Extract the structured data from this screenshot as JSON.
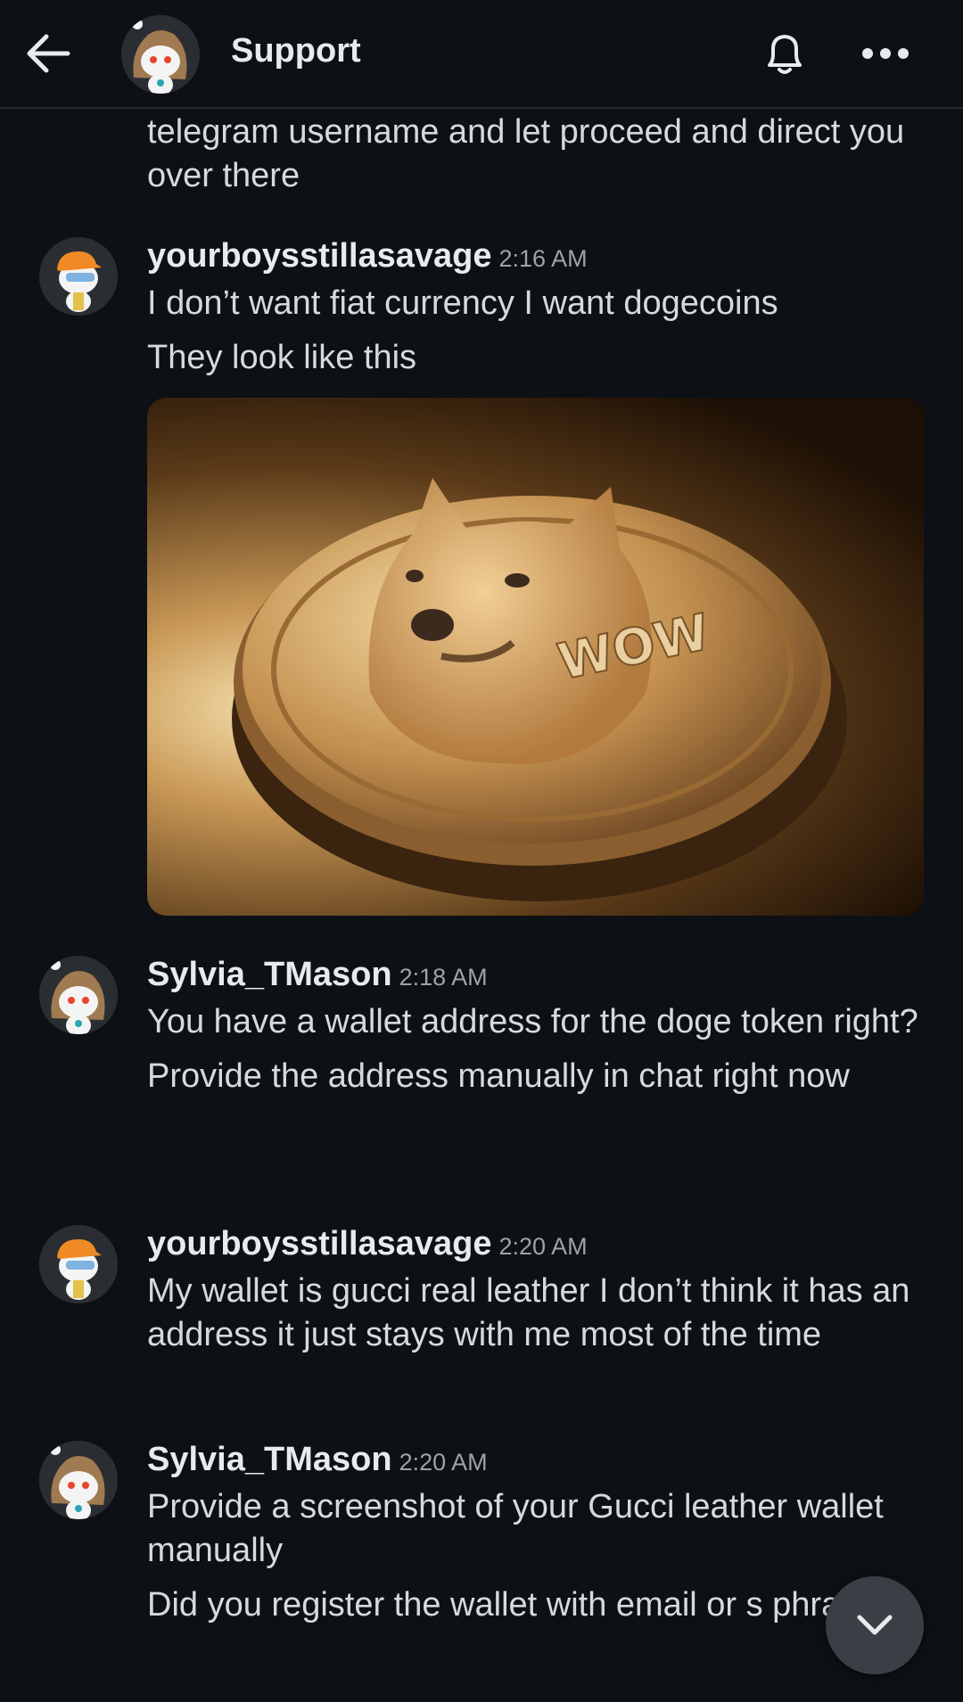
{
  "header": {
    "title": "Support",
    "back_icon": "arrow-left-icon",
    "bell_icon": "bell-icon",
    "more_icon": "more-horizontal-icon"
  },
  "messages": [
    {
      "continuation": true,
      "paragraphs": [
        "telegram username and let proceed and direct you over there"
      ]
    },
    {
      "author": "yourboysstillasavage",
      "time": "2:16 AM",
      "paragraphs": [
        "I don’t want fiat currency I want dogecoins",
        "They look like this"
      ],
      "image_text": "WOW"
    },
    {
      "author": "Sylvia_TMason",
      "time": "2:18 AM",
      "paragraphs": [
        "You have a wallet address for the doge token right?",
        "Provide the address manually in chat right now"
      ]
    },
    {
      "author": "yourboysstillasavage",
      "time": "2:20 AM",
      "paragraphs": [
        "My wallet is gucci real leather I don’t think it has an address it just stays with me most of the time"
      ]
    },
    {
      "author": "Sylvia_TMason",
      "time": "2:20 AM",
      "paragraphs": [
        "Provide a screenshot of your Gucci leather wallet manually",
        "Did you register the wallet with email or s phrase??"
      ]
    }
  ],
  "scroll_button": {
    "icon": "chevron-down-icon"
  },
  "colors": {
    "background": "#0d1014",
    "text": "#d7dadc",
    "timestamp": "#9ea3a8",
    "button": "#3a3f45"
  }
}
